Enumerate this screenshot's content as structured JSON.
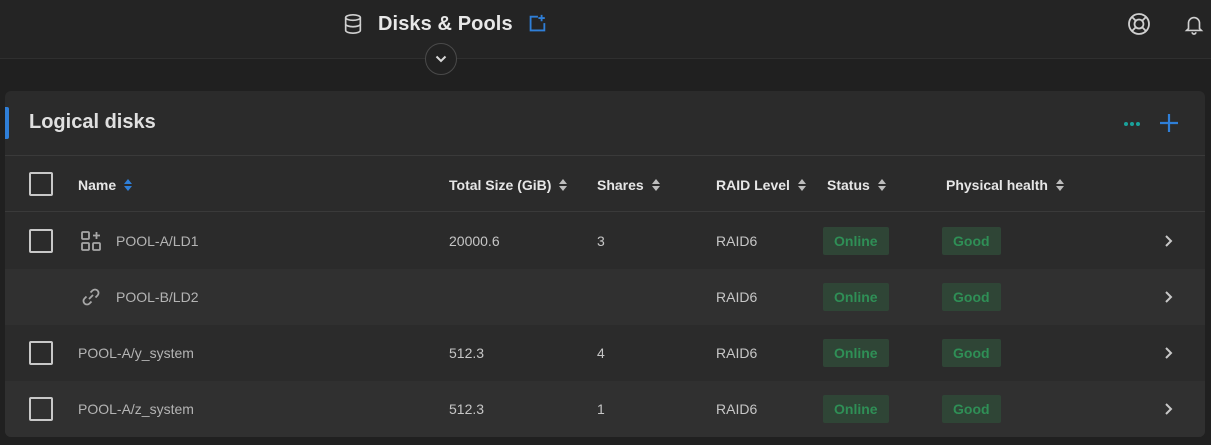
{
  "header": {
    "title": "Disks & Pools",
    "icons": [
      "database-icon",
      "open-in-new-icon",
      "help-lifebuoy-icon",
      "bell-icon",
      "chevron-down-icon"
    ]
  },
  "card": {
    "title": "Logical disks",
    "actions": [
      "more-icon",
      "plus-icon"
    ],
    "accent_color": "#2f7fd8"
  },
  "table": {
    "columns": {
      "name": "Name",
      "size": "Total Size (GiB)",
      "shares": "Shares",
      "raid": "RAID Level",
      "status": "Status",
      "health": "Physical health"
    },
    "rows": [
      {
        "name": "POOL-A/LD1",
        "icon": "group-add-icon",
        "size": "20000.6",
        "shares": "3",
        "raid": "RAID6",
        "status": "Online",
        "health": "Good",
        "has_checkbox": true
      },
      {
        "name": "POOL-B/LD2",
        "icon": "link-icon",
        "size": "",
        "shares": "",
        "raid": "RAID6",
        "status": "Online",
        "health": "Good",
        "has_checkbox": false
      },
      {
        "name": "POOL-A/y_system",
        "icon": "",
        "size": "512.3",
        "shares": "4",
        "raid": "RAID6",
        "status": "Online",
        "health": "Good",
        "has_checkbox": true
      },
      {
        "name": "POOL-A/z_system",
        "icon": "",
        "size": "512.3",
        "shares": "1",
        "raid": "RAID6",
        "status": "Online",
        "health": "Good",
        "has_checkbox": true
      }
    ]
  },
  "colors": {
    "status_bg": "#2f4536",
    "status_text": "#2f8f56",
    "sort_active": "#2f7fd8"
  }
}
